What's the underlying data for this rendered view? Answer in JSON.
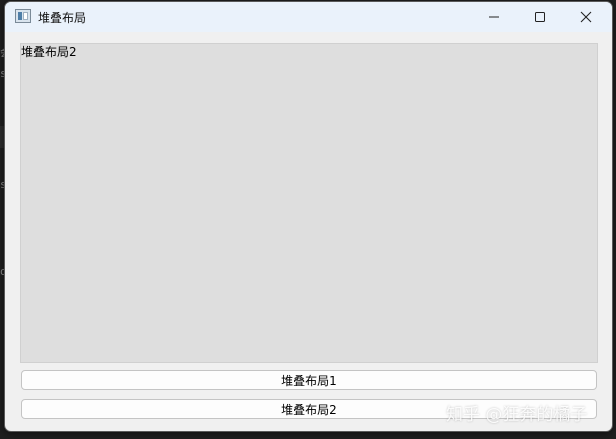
{
  "window": {
    "title": "堆叠布局"
  },
  "titlebar": {
    "app_icon": "window-app-icon",
    "minimize_icon": "minimize-icon",
    "maximize_icon": "maximize-icon",
    "close_icon": "close-icon"
  },
  "stack": {
    "current_page_label": "堆叠布局2"
  },
  "buttons": {
    "page1_label": "堆叠布局1",
    "page2_label": "堆叠布局2"
  },
  "watermark": {
    "text": "知乎 @狂奔的橘子"
  },
  "background_editor": {
    "fragments": [
      "会",
      "s",
      "s",
      "o"
    ]
  },
  "colors": {
    "titlebar": "#eaf2fb",
    "window": "#f0f0f0",
    "stack_page": "#dedede",
    "button": "#fdfdfd"
  }
}
